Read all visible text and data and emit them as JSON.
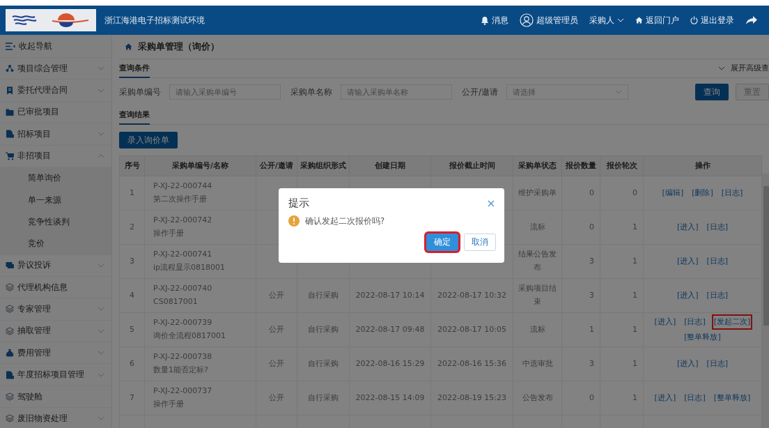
{
  "header": {
    "title": "浙江海港电子招标测试环境",
    "links": [
      {
        "kind": "bell",
        "label": "消息"
      },
      {
        "kind": "user",
        "label": "超级管理员"
      },
      {
        "kind": "dropdown",
        "label": "采购人"
      },
      {
        "kind": "home",
        "label": "返回门户"
      },
      {
        "kind": "power",
        "label": "退出登录"
      },
      {
        "kind": "share"
      }
    ]
  },
  "sidebar": {
    "collapse_label": "收起导航",
    "items": [
      {
        "label": "项目综合管理",
        "expandable": true,
        "expanded": false
      },
      {
        "label": "委托代理合同",
        "expandable": true,
        "expanded": false
      },
      {
        "label": "已审批项目",
        "expandable": false,
        "expanded": false
      },
      {
        "label": "招标项目",
        "expandable": true,
        "expanded": false
      },
      {
        "label": "非招项目",
        "expandable": true,
        "expanded": true,
        "children": [
          {
            "label": "简单询价"
          },
          {
            "label": "单一来源"
          },
          {
            "label": "竞争性谈判"
          },
          {
            "label": "竞价"
          }
        ]
      },
      {
        "label": "异议投诉",
        "expandable": true,
        "expanded": false
      },
      {
        "label": "代理机构信息",
        "expandable": false,
        "expanded": false
      },
      {
        "label": "专家管理",
        "expandable": true,
        "expanded": false
      },
      {
        "label": "抽取管理",
        "expandable": true,
        "expanded": false
      },
      {
        "label": "费用管理",
        "expandable": true,
        "expanded": false
      },
      {
        "label": "年度招标项目管理",
        "expandable": true,
        "expanded": false
      },
      {
        "label": "驾驶舱",
        "expandable": false,
        "expanded": false
      },
      {
        "label": "废旧物资处理",
        "expandable": true,
        "expanded": false
      }
    ]
  },
  "breadcrumb": "采购单管理（询价）",
  "query": {
    "section_title": "查询条件",
    "advanced_toggle": "展开高级查",
    "fields": [
      {
        "kind": "text",
        "label": "采购单编号",
        "placeholder": "请输入采购单编号"
      },
      {
        "kind": "text",
        "label": "采购单名称",
        "placeholder": "请输入采购单名称"
      },
      {
        "kind": "select",
        "label": "公开/邀请",
        "placeholder": "请选择"
      }
    ],
    "buttons": [
      {
        "kind": "primary",
        "label": "查询"
      },
      {
        "kind": "default",
        "label": "重置"
      }
    ]
  },
  "results": {
    "section_title": "查询结果",
    "add_button": "录入询价单"
  },
  "table": {
    "columns": [
      "序号",
      "采购单编号/名称",
      "公开/邀请",
      "采购组织形式",
      "创建日期",
      "报价截止时间",
      "采购单状态",
      "报价数量",
      "报价轮次",
      "操作"
    ],
    "rows": [
      {
        "seq": "1",
        "code": "P-XJ-22-000744",
        "name": "第二次操作手册",
        "status": "维护采购单",
        "count": "0",
        "round": "0",
        "actions": [
          {
            "label": "[编辑]",
            "highlighted": false
          },
          {
            "label": "[删除]",
            "highlighted": false
          },
          {
            "label": "[日志]",
            "highlighted": false
          }
        ]
      },
      {
        "seq": "2",
        "code": "P-XJ-22-000742",
        "name": "操作手册",
        "status": "流标",
        "count": "0",
        "round": "1",
        "actions": [
          {
            "label": "[进入]",
            "highlighted": false
          },
          {
            "label": "[日志]",
            "highlighted": false
          }
        ]
      },
      {
        "seq": "3",
        "code": "P-XJ-22-000741",
        "name": "ip流程显示0818001",
        "status": "结果公告发布",
        "count": "3",
        "round": "1",
        "actions": [
          {
            "label": "[进入]",
            "highlighted": false
          },
          {
            "label": "[日志]",
            "highlighted": false
          }
        ]
      },
      {
        "seq": "4",
        "code": "P-XJ-22-000740",
        "name": "CS0817001",
        "open": "公开",
        "form": "自行采购",
        "created": "2022-08-17 10:14",
        "deadline": "2022-08-17 10:32",
        "status": "采购项目结束",
        "count": "3",
        "round": "1",
        "actions": [
          {
            "label": "[进入]",
            "highlighted": false
          },
          {
            "label": "[日志]",
            "highlighted": false
          }
        ]
      },
      {
        "seq": "5",
        "code": "P-XJ-22-000739",
        "name": "询价全流程0817001",
        "open": "公开",
        "form": "自行采购",
        "created": "2022-08-17 09:48",
        "deadline": "2022-08-17 10:05",
        "status": "流标",
        "count": "1",
        "round": "1",
        "actions": [
          {
            "label": "[进入]",
            "highlighted": false
          },
          {
            "label": "[日志]",
            "highlighted": false
          },
          {
            "label": "[发起二次]",
            "highlighted": true
          },
          {
            "label": "[整单释放]",
            "highlighted": false
          }
        ]
      },
      {
        "seq": "6",
        "code": "P-XJ-22-000738",
        "name": "数量1能否定标?",
        "open": "公开",
        "form": "自行采购",
        "created": "2022-08-16 15:29",
        "deadline": "2022-08-16 15:36",
        "status": "中选审批",
        "count": "3",
        "round": "1",
        "actions": [
          {
            "label": "[进入]",
            "highlighted": false
          },
          {
            "label": "[日志]",
            "highlighted": false
          }
        ]
      },
      {
        "seq": "7",
        "code": "P-XJ-22-000737",
        "name": "操作手册",
        "open": "公开",
        "form": "自行采购",
        "created": "2022-08-15 14:09",
        "deadline": "2022-08-19 15:23",
        "status": "公告发布",
        "count": "0",
        "round": "1",
        "actions": [
          {
            "label": "[进入]",
            "highlighted": false
          },
          {
            "label": "[日志]",
            "highlighted": false
          },
          {
            "label": "[整单释放]",
            "highlighted": false
          }
        ]
      }
    ]
  },
  "dialog": {
    "title": "提示",
    "message": "确认发起二次报价吗?",
    "buttons": [
      {
        "kind": "primary",
        "label": "确定",
        "highlighted": true
      },
      {
        "kind": "default",
        "label": "取消",
        "highlighted": false
      }
    ]
  }
}
